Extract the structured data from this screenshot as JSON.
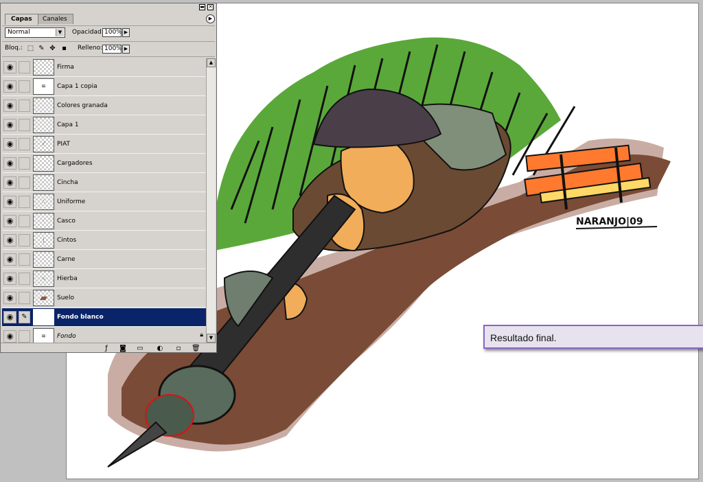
{
  "palette": {
    "tabs": [
      "Capas",
      "Canales"
    ],
    "menu_arrow_icon": "triangle-right-icon",
    "blend_mode": "Normal",
    "opacity_label": "Opacidad:",
    "opacity_value": "100%",
    "lock_label": "Bloq.:",
    "fill_label": "Relleno:",
    "fill_value": "100%",
    "layers": [
      {
        "name": "Firma"
      },
      {
        "name": "Capa 1 copia"
      },
      {
        "name": "Colores granada"
      },
      {
        "name": "Capa 1"
      },
      {
        "name": "PIAT"
      },
      {
        "name": "Cargadores"
      },
      {
        "name": "Cincha"
      },
      {
        "name": "Uniforme"
      },
      {
        "name": "Casco"
      },
      {
        "name": "Cintos"
      },
      {
        "name": "Carne"
      },
      {
        "name": "Hierba"
      },
      {
        "name": "Suelo"
      },
      {
        "name": "Fondo blanco"
      },
      {
        "name": "Fondo"
      }
    ]
  },
  "canvas": {
    "caption": "Resultado final.",
    "signature": "NARANJO|09"
  },
  "colors": {
    "selection": "#0a246a",
    "caption_border": "#8a63c9",
    "caption_bg": "#e6e2ee"
  }
}
